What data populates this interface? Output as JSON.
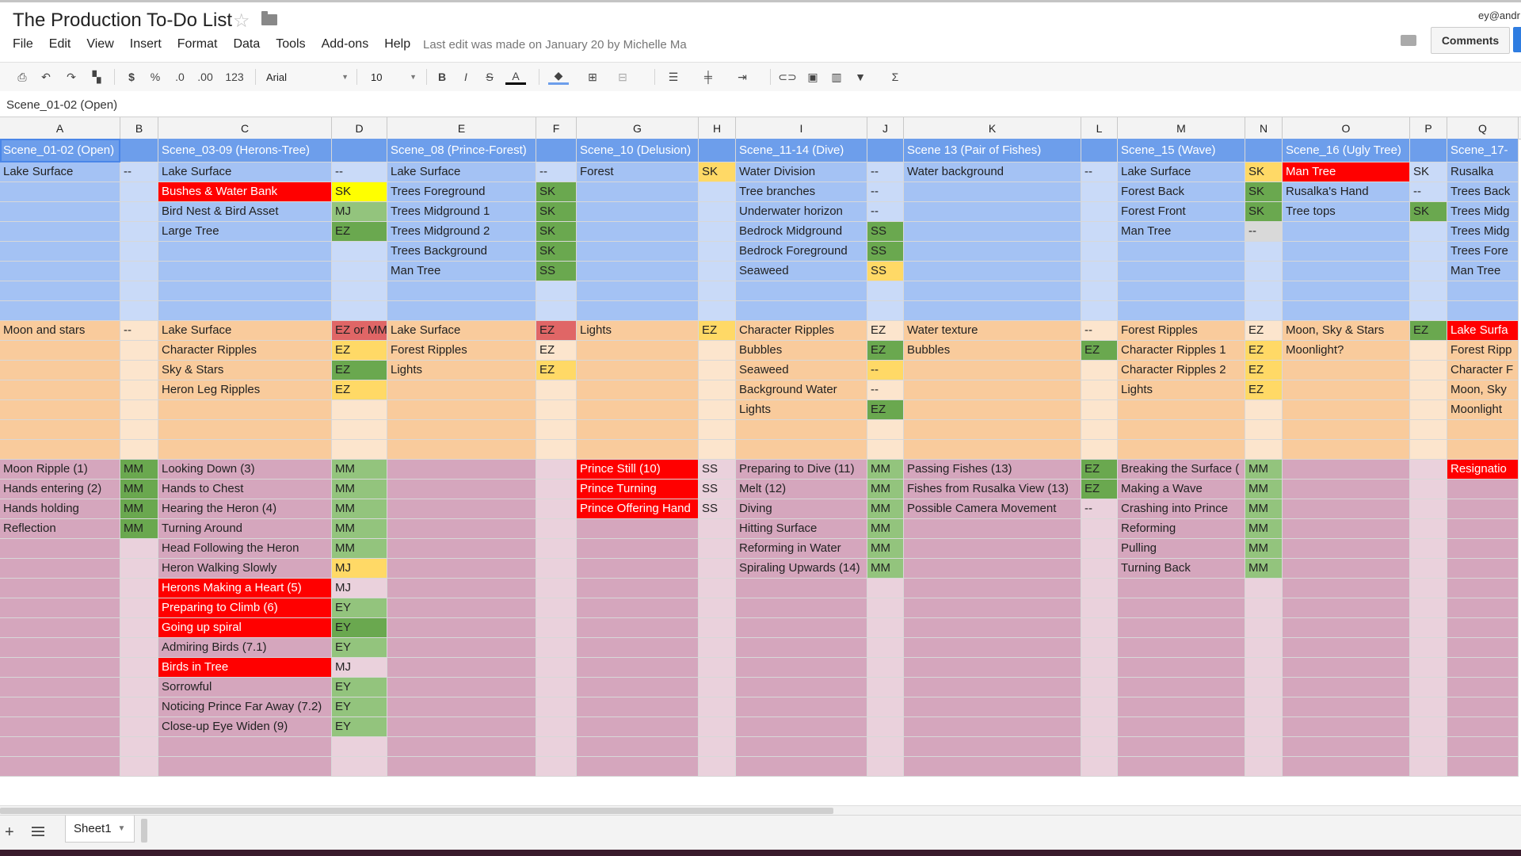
{
  "doc": {
    "title": "The Production To-Do List",
    "last_edit": "Last edit was made on January 20 by Michelle Ma",
    "account": "ey@andr",
    "comments_label": "Comments"
  },
  "menu": [
    "File",
    "Edit",
    "View",
    "Insert",
    "Format",
    "Data",
    "Tools",
    "Add-ons",
    "Help"
  ],
  "toolbar": {
    "currency": "$",
    "percent": "%",
    "dec_less": ".0",
    "dec_more": ".00",
    "more_formats": "123",
    "font": "Arial",
    "size": "10",
    "bold": "B",
    "italic": "I",
    "strike": "S",
    "textcolor": "A",
    "sum": "Σ"
  },
  "formula": "Scene_01-02 (Open)",
  "colors": {
    "header_blue": "#6d9eeb",
    "blue": "#a4c2f4",
    "blue_light": "#c9daf8",
    "orange": "#f9cb9c",
    "orange_light": "#fce5cd",
    "pink": "#d5a6bd",
    "pink_light": "#ead1dc",
    "red": "#ff0000",
    "yellow": "#ffff00",
    "green": "#93c47d",
    "dark_green": "#6aa84f",
    "gold": "#ffd966",
    "red_pale": "#e06666",
    "gray_light": "#d9d9d9"
  },
  "columns": [
    "A",
    "B",
    "C",
    "D",
    "E",
    "F",
    "G",
    "H",
    "I",
    "J",
    "K",
    "L",
    "M",
    "N",
    "O",
    "P",
    "Q"
  ],
  "headers": [
    "Scene_01-02 (Open)",
    "",
    "Scene_03-09 (Herons-Tree)",
    "",
    "Scene_08 (Prince-Forest)",
    "",
    "Scene_10 (Delusion)",
    "",
    "Scene_11-14 (Dive)",
    "",
    "Scene 13 (Pair of Fishes)",
    "",
    "Scene_15 (Wave)",
    "",
    "Scene_16 (Ugly Tree)",
    "",
    "Scene_17-"
  ],
  "row_group": [
    "blue",
    "blue",
    "blue",
    "blue",
    "blue",
    "blue",
    "blue",
    "blue",
    "orange",
    "orange",
    "orange",
    "orange",
    "orange",
    "orange",
    "orange",
    "pink",
    "pink",
    "pink",
    "pink",
    "pink",
    "pink",
    "pink",
    "pink",
    "pink",
    "pink",
    "pink",
    "pink",
    "pink",
    "pink",
    "pink",
    "pink"
  ],
  "rows": [
    [
      "Lake Surface",
      "--",
      "Lake Surface",
      "--",
      "Lake Surface",
      "--",
      "Forest",
      "SK",
      "Water Division",
      "--",
      "Water background",
      "--",
      "Lake Surface",
      "SK",
      "Man Tree",
      "SK",
      "Rusalka"
    ],
    [
      "",
      "",
      "Bushes & Water Bank",
      "SK",
      "Trees Foreground",
      "SK",
      "",
      "",
      "Tree branches",
      "--",
      "",
      "",
      "Forest Back",
      "SK",
      "Rusalka's Hand",
      "--",
      "Trees Back"
    ],
    [
      "",
      "",
      "Bird Nest & Bird Asset",
      "MJ",
      "Trees Midground 1",
      "SK",
      "",
      "",
      "Underwater horizon",
      "--",
      "",
      "",
      "Forest Front",
      "SK",
      "Tree tops",
      "SK",
      "Trees Midg"
    ],
    [
      "",
      "",
      "Large Tree",
      "EZ",
      "Trees Midground 2",
      "SK",
      "",
      "",
      "Bedrock Midground",
      "SS",
      "",
      "",
      "Man Tree",
      "--",
      "",
      "",
      "Trees Midg"
    ],
    [
      "",
      "",
      "",
      "",
      "Trees Background",
      "SK",
      "",
      "",
      "Bedrock Foreground",
      "SS",
      "",
      "",
      "",
      "",
      "",
      "",
      "Trees Fore"
    ],
    [
      "",
      "",
      "",
      "",
      "Man Tree",
      "SS",
      "",
      "",
      "Seaweed",
      "SS",
      "",
      "",
      "",
      "",
      "",
      "",
      "Man Tree"
    ],
    [
      "",
      "",
      "",
      "",
      "",
      "",
      "",
      "",
      "",
      "",
      "",
      "",
      "",
      "",
      "",
      "",
      ""
    ],
    [
      "",
      "",
      "",
      "",
      "",
      "",
      "",
      "",
      "",
      "",
      "",
      "",
      "",
      "",
      "",
      "",
      ""
    ],
    [
      "Moon and stars",
      "--",
      "Lake Surface",
      "EZ or MM?",
      "Lake Surface",
      "EZ",
      "Lights",
      "EZ",
      "Character Ripples",
      "EZ",
      "Water texture",
      "--",
      "Forest Ripples",
      "EZ",
      "Moon, Sky & Stars",
      "EZ",
      "Lake Surfa"
    ],
    [
      "",
      "",
      "Character Ripples",
      "EZ",
      "Forest Ripples",
      "EZ",
      "",
      "",
      "Bubbles",
      "EZ",
      "Bubbles",
      "EZ",
      "Character Ripples 1",
      "EZ",
      "Moonlight?",
      "",
      "Forest Ripp"
    ],
    [
      "",
      "",
      "Sky & Stars",
      "EZ",
      "Lights",
      "EZ",
      "",
      "",
      "Seaweed",
      "--",
      "",
      "",
      "Character Ripples 2",
      "EZ",
      "",
      "",
      "Character F"
    ],
    [
      "",
      "",
      "Heron Leg Ripples",
      "EZ",
      "",
      "",
      "",
      "",
      "Background Water",
      "--",
      "",
      "",
      "Lights",
      "EZ",
      "",
      "",
      "Moon, Sky"
    ],
    [
      "",
      "",
      "",
      "",
      "",
      "",
      "",
      "",
      "Lights",
      "EZ",
      "",
      "",
      "",
      "",
      "",
      "",
      "Moonlight"
    ],
    [
      "",
      "",
      "",
      "",
      "",
      "",
      "",
      "",
      "",
      "",
      "",
      "",
      "",
      "",
      "",
      "",
      ""
    ],
    [
      "",
      "",
      "",
      "",
      "",
      "",
      "",
      "",
      "",
      "",
      "",
      "",
      "",
      "",
      "",
      "",
      ""
    ],
    [
      "Moon Ripple (1)",
      "MM",
      "Looking Down (3)",
      "MM",
      "",
      "",
      "Prince Still (10)",
      "SS",
      "Preparing to Dive (11)",
      "MM",
      "Passing Fishes (13)",
      "EZ",
      "Breaking the Surface (",
      "MM",
      "",
      "",
      "Resignatio"
    ],
    [
      "Hands entering (2)",
      "MM",
      "Hands to Chest",
      "MM",
      "",
      "",
      "Prince Turning",
      "SS",
      "Melt (12)",
      "MM",
      "Fishes from Rusalka View (13)",
      "EZ",
      "Making a Wave",
      "MM",
      "",
      "",
      ""
    ],
    [
      "Hands holding",
      "MM",
      "Hearing the Heron (4)",
      "MM",
      "",
      "",
      "Prince Offering Hand",
      "SS",
      "Diving",
      "MM",
      "Possible Camera Movement",
      "--",
      "Crashing into Prince",
      "MM",
      "",
      "",
      ""
    ],
    [
      "Reflection",
      "MM",
      "Turning Around",
      "MM",
      "",
      "",
      "",
      "",
      "Hitting Surface",
      "MM",
      "",
      "",
      "Reforming",
      "MM",
      "",
      "",
      ""
    ],
    [
      "",
      "",
      "Head Following the Heron",
      "MM",
      "",
      "",
      "",
      "",
      "Reforming in Water",
      "MM",
      "",
      "",
      "Pulling",
      "MM",
      "",
      "",
      ""
    ],
    [
      "",
      "",
      "Heron Walking Slowly",
      "MJ",
      "",
      "",
      "",
      "",
      "Spiraling Upwards (14)",
      "MM",
      "",
      "",
      "Turning Back",
      "MM",
      "",
      "",
      ""
    ],
    [
      "",
      "",
      "Herons Making a Heart (5)",
      "MJ",
      "",
      "",
      "",
      "",
      "",
      "",
      "",
      "",
      "",
      "",
      "",
      "",
      ""
    ],
    [
      "",
      "",
      "Preparing to Climb (6)",
      "EY",
      "",
      "",
      "",
      "",
      "",
      "",
      "",
      "",
      "",
      "",
      "",
      "",
      ""
    ],
    [
      "",
      "",
      "Going up spiral",
      "EY",
      "",
      "",
      "",
      "",
      "",
      "",
      "",
      "",
      "",
      "",
      "",
      "",
      ""
    ],
    [
      "",
      "",
      "Admiring Birds (7.1)",
      "EY",
      "",
      "",
      "",
      "",
      "",
      "",
      "",
      "",
      "",
      "",
      "",
      "",
      ""
    ],
    [
      "",
      "",
      "Birds in Tree",
      "MJ",
      "",
      "",
      "",
      "",
      "",
      "",
      "",
      "",
      "",
      "",
      "",
      "",
      ""
    ],
    [
      "",
      "",
      "Sorrowful",
      "EY",
      "",
      "",
      "",
      "",
      "",
      "",
      "",
      "",
      "",
      "",
      "",
      "",
      ""
    ],
    [
      "",
      "",
      "Noticing Prince Far Away (7.2)",
      "EY",
      "",
      "",
      "",
      "",
      "",
      "",
      "",
      "",
      "",
      "",
      "",
      "",
      ""
    ],
    [
      "",
      "",
      "Close-up Eye Widen (9)",
      "EY",
      "",
      "",
      "",
      "",
      "",
      "",
      "",
      "",
      "",
      "",
      "",
      "",
      ""
    ],
    [
      "",
      "",
      "",
      "",
      "",
      "",
      "",
      "",
      "",
      "",
      "",
      "",
      "",
      "",
      "",
      "",
      ""
    ],
    [
      "",
      "",
      "",
      "",
      "",
      "",
      "",
      "",
      "",
      "",
      "",
      "",
      "",
      "",
      "",
      "",
      ""
    ]
  ],
  "cell_fills": {
    "1,2": "red",
    "1,3": "yellow",
    "0,7": "gold",
    "0,13": "gold",
    "0,14": "red",
    "1,5": "dark_green",
    "1,13": "dark_green",
    "2,3": "green",
    "2,5": "dark_green",
    "2,13": "dark_green",
    "2,15": "dark_green",
    "3,3": "dark_green",
    "3,5": "dark_green",
    "3,9": "dark_green",
    "3,13": "gray_light",
    "4,5": "dark_green",
    "4,9": "dark_green",
    "5,5": "dark_green",
    "5,9": "gold",
    "8,3": "red_pale",
    "8,5": "red_pale",
    "8,7": "gold",
    "8,15": "dark_green",
    "8,16": "red",
    "9,3": "gold",
    "9,9": "dark_green",
    "9,11": "dark_green",
    "9,13": "gold",
    "10,3": "dark_green",
    "10,5": "gold",
    "10,9": "gold",
    "10,13": "gold",
    "11,3": "gold",
    "11,13": "gold",
    "12,9": "dark_green",
    "15,1": "dark_green",
    "15,3": "green",
    "15,6": "red",
    "15,9": "green",
    "15,11": "dark_green",
    "15,13": "green",
    "15,16": "red",
    "16,1": "dark_green",
    "16,3": "green",
    "16,6": "red",
    "16,9": "green",
    "16,11": "dark_green",
    "16,13": "green",
    "17,1": "dark_green",
    "17,3": "green",
    "17,6": "red",
    "17,9": "green",
    "17,13": "green",
    "18,1": "dark_green",
    "18,3": "green",
    "18,9": "green",
    "18,13": "green",
    "19,3": "green",
    "19,9": "green",
    "19,13": "green",
    "20,3": "gold",
    "20,9": "green",
    "20,13": "green",
    "21,2": "red",
    "22,2": "red",
    "22,3": "green",
    "23,2": "red",
    "23,3": "dark_green",
    "24,3": "green",
    "25,2": "red",
    "26,3": "green",
    "27,3": "green",
    "28,3": "green"
  },
  "white_text": [
    "1,2",
    "0,14",
    "8,16",
    "15,6",
    "16,6",
    "17,6",
    "15,16",
    "21,2",
    "22,2",
    "23,2",
    "25,2"
  ],
  "sheet_tab": "Sheet1"
}
